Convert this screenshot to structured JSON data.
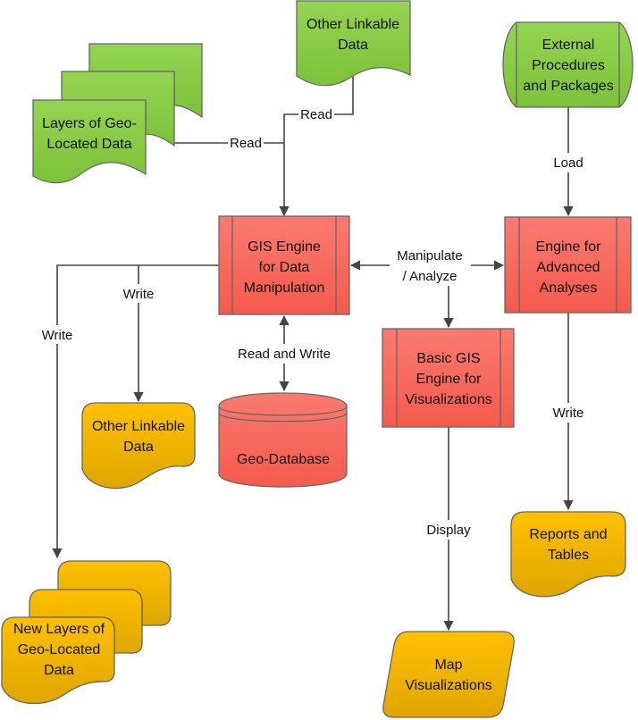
{
  "colors": {
    "input": "#8cce4c",
    "process": "#f96c60",
    "output": "#fcbc08",
    "connector": "#444444"
  },
  "nodes": {
    "layers_geo": {
      "lines": [
        "Layers of Geo-",
        "Located Data"
      ]
    },
    "other_linkable_in": {
      "lines": [
        "Other Linkable",
        "Data"
      ]
    },
    "external": {
      "lines": [
        "External",
        "Procedures",
        "and Packages"
      ]
    },
    "gis_engine": {
      "lines": [
        "GIS Engine",
        "for Data",
        "Manipulation"
      ]
    },
    "advanced": {
      "lines": [
        "Engine for",
        "Advanced",
        "Analyses"
      ]
    },
    "basic_gis": {
      "lines": [
        "Basic GIS",
        "Engine for",
        "Visualizations"
      ]
    },
    "other_linkable_out": {
      "lines": [
        "Other Linkable",
        "Data"
      ]
    },
    "geo_database": {
      "lines": [
        "Geo-Database"
      ]
    },
    "new_layers": {
      "lines": [
        "New Layers of",
        "Geo-Located",
        "Data"
      ]
    },
    "reports": {
      "lines": [
        "Reports and",
        "Tables"
      ]
    },
    "map_vis": {
      "lines": [
        "Map",
        "Visualizations"
      ]
    }
  },
  "edges": {
    "read_layers": "Read",
    "read_other": "Read",
    "load": "Load",
    "manipulate": [
      "Manipulate",
      "/ Analyze"
    ],
    "write_other": "Write",
    "write_new_layers": "Write",
    "read_write": "Read and Write",
    "write_reports": "Write",
    "display": "Display"
  }
}
